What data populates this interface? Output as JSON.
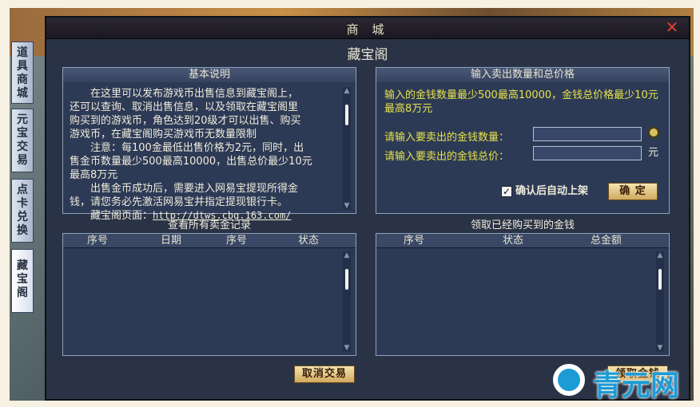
{
  "window": {
    "title": "商 城",
    "subtitle": "藏宝阁",
    "close_glyph": "✕"
  },
  "tabs": [
    {
      "label": "道\n具\n商\n城"
    },
    {
      "label": "元\n宝\n交\n易"
    },
    {
      "label": "点\n卡\n兑\n换"
    },
    {
      "label": "藏\n宝\n阁"
    }
  ],
  "basic_info": {
    "title": "基本说明",
    "lines": [
      "　　在这里可以发布游戏币出售信息到藏宝阁上，",
      "还可以查询、取消出售信息，以及领取在藏宝阁里",
      "购买到的游戏币，角色达到20级才可以出售、购买",
      "游戏币，在藏宝阁购买游戏币无数量限制",
      "　　注意：每100金最低出售价格为2元，同时，出",
      "售金币数量最少500最高10000，出售总价最少10元",
      "最高8万元",
      "　　出售金币成功后，需要进入网易宝提现所得金",
      "钱，请您务必先激活网易宝并指定提现银行卡。",
      "　　藏宝阁页面："
    ],
    "link": "http://dtws.cbg.163.com/"
  },
  "sell_form": {
    "title": "输入卖出数量和总价格",
    "desc": "输入的金钱数量最少500最高10000，金钱总价格最少10元最高8万元",
    "amount_label": "请输入要卖出的金钱数量：",
    "price_label": "请输入要卖出的金钱总价：",
    "amount_value": "",
    "price_value": "",
    "price_unit": "元",
    "auto_list_label": "确认后自动上架",
    "auto_list_checked": true,
    "confirm_label": "确 定"
  },
  "sell_records": {
    "title": "查看所有卖金记录",
    "columns": [
      "序号",
      "日期",
      "序号",
      "状态"
    ],
    "rows": [],
    "cancel_label": "取消交易"
  },
  "bought_money": {
    "title": "领取已经购买到的金钱",
    "columns": [
      "序号",
      "状态",
      "总金额"
    ],
    "rows": [],
    "claim_label": "领取金钱"
  },
  "watermark": {
    "text": "青元网"
  },
  "colors": {
    "highlight_text": "#e6e24a",
    "panel_bg": "#2d3a56",
    "button_bg": "#e6c880"
  }
}
